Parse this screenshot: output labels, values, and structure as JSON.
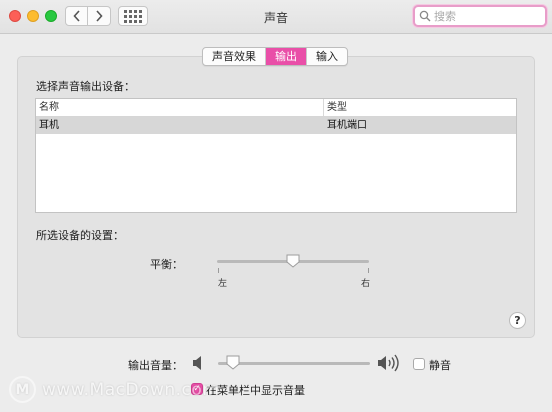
{
  "window": {
    "title": "声音",
    "search_placeholder": "搜索"
  },
  "tabs": [
    {
      "label": "声音效果",
      "active": false
    },
    {
      "label": "输出",
      "active": true
    },
    {
      "label": "输入",
      "active": false
    }
  ],
  "output": {
    "device_section_label": "选择声音输出设备：",
    "columns": {
      "name": "名称",
      "type": "类型"
    },
    "rows": [
      {
        "name": "耳机",
        "type": "耳机端口",
        "selected": true
      }
    ],
    "settings_label": "所选设备的设置：",
    "balance": {
      "label": "平衡：",
      "left_label": "左",
      "right_label": "右",
      "value": 0.5
    }
  },
  "volume": {
    "label": "输出音量：",
    "value": 0.1,
    "mute_label": "静音",
    "muted": false,
    "show_in_menubar_label": "在菜单栏中显示音量",
    "show_in_menubar": true
  },
  "help_label": "?",
  "watermark": {
    "text": "www.MacDown.com",
    "logo": "M"
  },
  "colors": {
    "accent": "#e94fa8"
  },
  "icons": {
    "back": "chevron-left-icon",
    "forward": "chevron-right-icon",
    "grid": "app-grid-icon",
    "search": "search-icon",
    "speaker_low": "speaker-low-icon",
    "speaker_high": "speaker-high-icon"
  }
}
